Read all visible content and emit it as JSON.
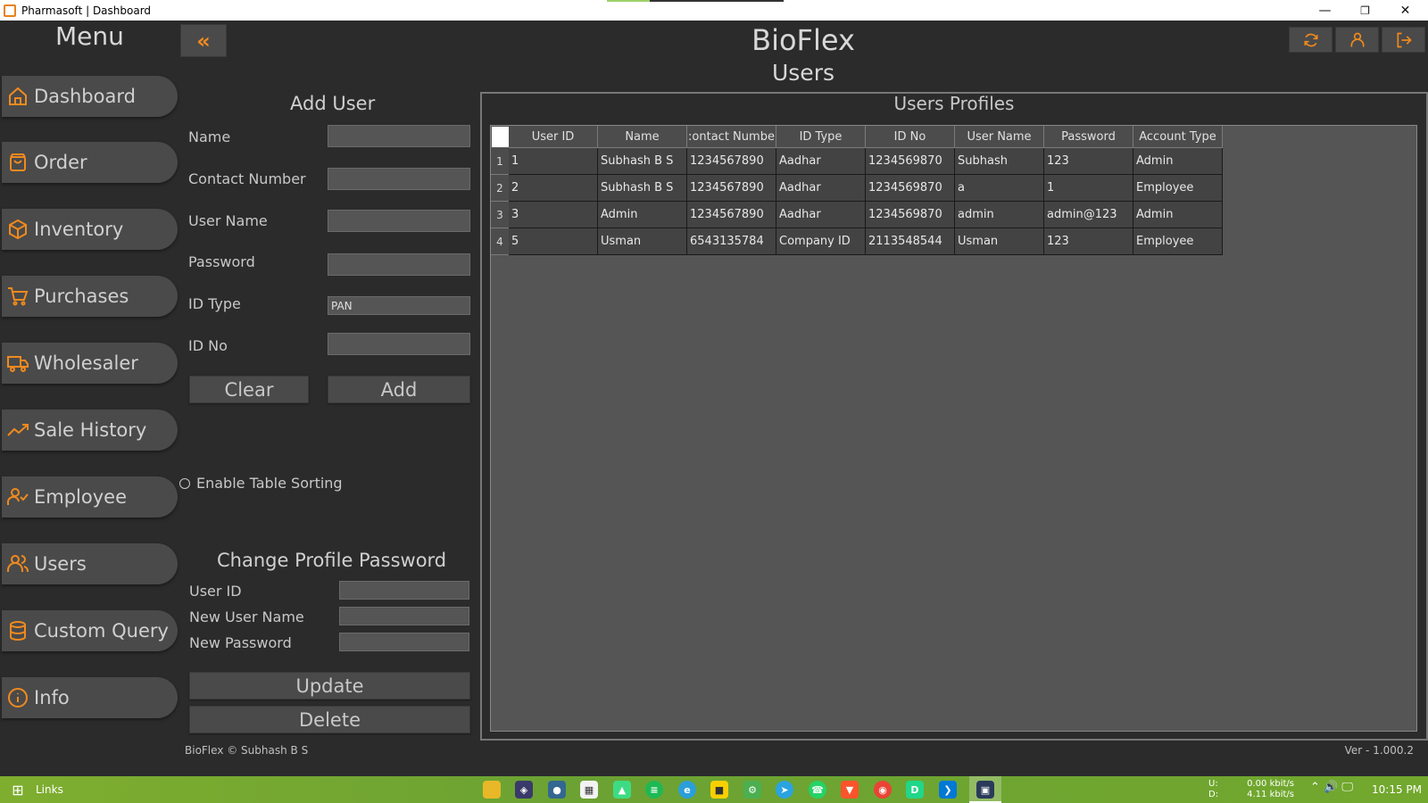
{
  "window": {
    "title": "Pharmasoft | Dashboard",
    "minimize": "—",
    "restore": "❐",
    "close": "✕"
  },
  "sidebar": {
    "title": "Menu",
    "collapse_label": "«",
    "items": [
      {
        "label": "Dashboard",
        "icon": "home-icon"
      },
      {
        "label": "Order",
        "icon": "bag-icon"
      },
      {
        "label": "Inventory",
        "icon": "box-icon"
      },
      {
        "label": "Purchases",
        "icon": "cart-icon"
      },
      {
        "label": "Wholesaler",
        "icon": "truck-icon"
      },
      {
        "label": "Sale History",
        "icon": "trend-icon"
      },
      {
        "label": "Employee",
        "icon": "user-check-icon"
      },
      {
        "label": "Users",
        "icon": "users-icon"
      },
      {
        "label": "Custom Query",
        "icon": "database-icon"
      },
      {
        "label": "Info",
        "icon": "info-icon"
      }
    ]
  },
  "header": {
    "app_name": "BioFlex",
    "page_name": "Users"
  },
  "add_user": {
    "title": "Add User",
    "name_label": "Name",
    "name_value": "",
    "contact_label": "Contact Number",
    "contact_value": "",
    "username_label": "User Name",
    "username_value": "",
    "password_label": "Password",
    "password_value": "",
    "idtype_label": "ID Type",
    "idtype_value": "PAN",
    "idno_label": "ID No",
    "idno_value": "",
    "clear_label": "Clear",
    "add_label": "Add"
  },
  "sorting": {
    "label": "Enable Table Sorting",
    "checked": false
  },
  "change_password": {
    "title": "Change Profile Password",
    "userid_label": "User ID",
    "newusername_label": "New User Name",
    "newpassword_label": "New Password",
    "update_label": "Update",
    "delete_label": "Delete"
  },
  "table": {
    "title": "Users Profiles",
    "columns": [
      "User ID",
      "Name",
      ":ontact Numbe",
      "ID Type",
      "ID No",
      "User Name",
      "Password",
      "Account Type"
    ],
    "rows": [
      {
        "num": "1",
        "cells": [
          "1",
          "Subhash B S",
          "1234567890",
          "Aadhar",
          "1234569870",
          "Subhash",
          "123",
          "Admin"
        ]
      },
      {
        "num": "2",
        "cells": [
          "2",
          "Subhash B S",
          "1234567890",
          "Aadhar",
          "1234569870",
          "a",
          "1",
          "Employee"
        ]
      },
      {
        "num": "3",
        "cells": [
          "3",
          "Admin",
          "1234567890",
          "Aadhar",
          "1234569870",
          "admin",
          "admin@123",
          "Admin"
        ]
      },
      {
        "num": "4",
        "cells": [
          "5",
          "Usman",
          "6543135784",
          "Company ID",
          "2113548544",
          "Usman",
          "123",
          "Employee"
        ]
      }
    ]
  },
  "footer": {
    "copyright": "BioFlex © Subhash B S",
    "version": "Ver - 1.000.2"
  },
  "taskbar": {
    "links_label": "Links",
    "upload_label": "U:",
    "download_label": "D:",
    "upload_speed": "0.00 kbit/s",
    "download_speed": "4.11 kbit/s",
    "time": "10:15 PM"
  },
  "colors": {
    "accent": "#f08a1e",
    "background": "#2b2b2b",
    "button": "#4a4a4a",
    "taskbar": "#72a82e"
  }
}
